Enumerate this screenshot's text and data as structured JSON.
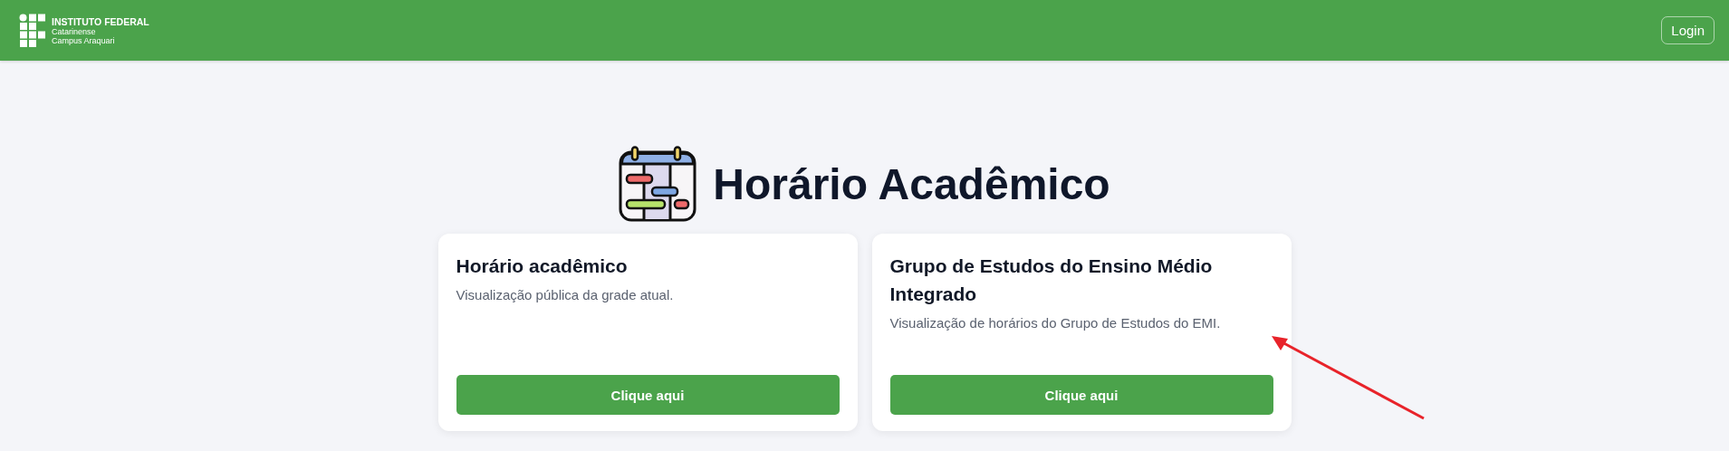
{
  "header": {
    "logo": {
      "title": "INSTITUTO FEDERAL",
      "subtitle_1": "Catarinense",
      "subtitle_2": "Campus Araquari"
    },
    "login_button": "Login"
  },
  "page_title": "Horário Acadêmico",
  "cards": [
    {
      "title": "Horário acadêmico",
      "description": "Visualização pública da grade atual.",
      "button": "Clique aqui"
    },
    {
      "title": "Grupo de Estudos do Ensino Médio Integrado",
      "description": "Visualização de horários do Grupo de Estudos do EMI.",
      "button": "Clique aqui"
    }
  ]
}
